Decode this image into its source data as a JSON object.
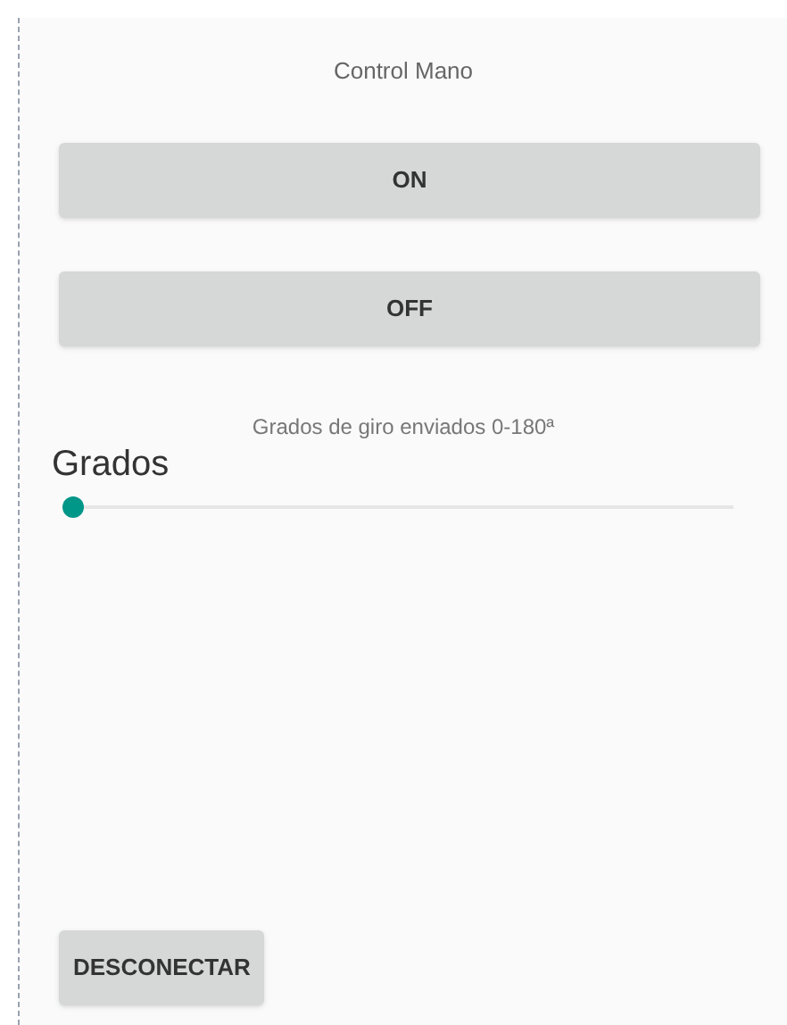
{
  "title": "Control Mano",
  "buttons": [
    "ON",
    "OFF"
  ],
  "caption": "Grados de giro enviados 0-180ª",
  "slider": {
    "label": "Grados",
    "level": 0
  },
  "disconnect_button": "DESCONECTAR"
}
